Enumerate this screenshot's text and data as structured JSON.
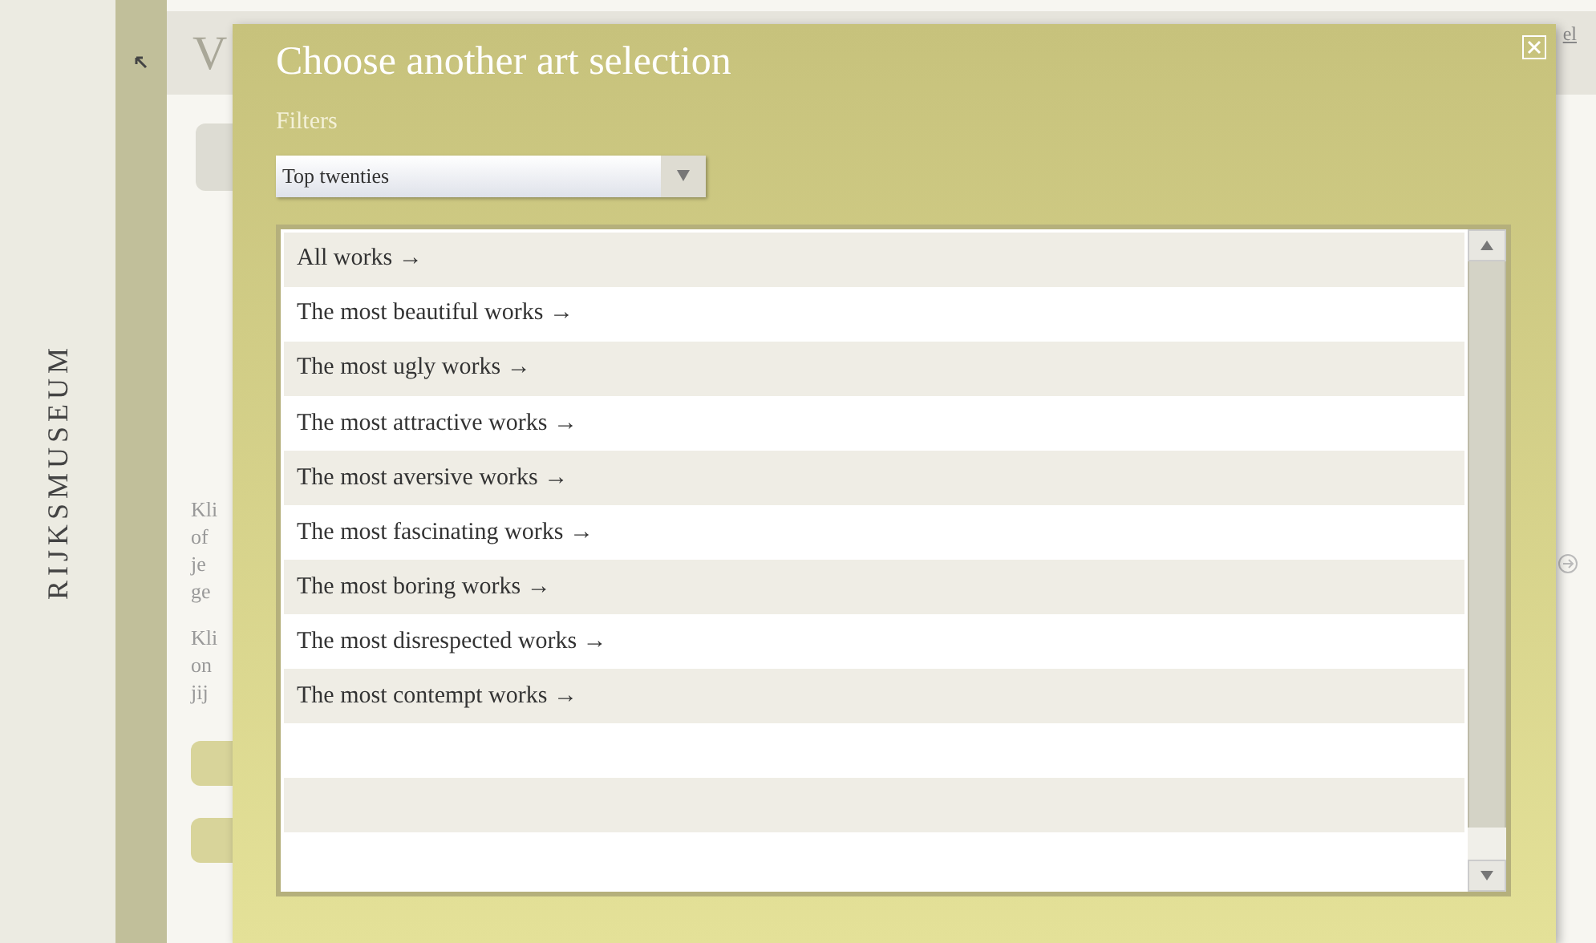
{
  "sidebar": {
    "logo": "RIJKSMUSEUM"
  },
  "page": {
    "title_fragment": "V",
    "link_fragment": "el",
    "paragraphs": [
      [
        "Kli",
        "of",
        "je",
        "ge"
      ],
      [
        "Kli",
        "on",
        "jij"
      ]
    ]
  },
  "dialog": {
    "title": "Choose another art selection",
    "filter_label": "Filters",
    "filter": {
      "value": "Top twenties"
    },
    "items": [
      {
        "label": "All works →"
      },
      {
        "label": "The most beautiful works →"
      },
      {
        "label": "The most ugly works →"
      },
      {
        "label": "The most attractive works →"
      },
      {
        "label": "The most aversive works →"
      },
      {
        "label": "The most fascinating works →"
      },
      {
        "label": "The most boring works →"
      },
      {
        "label": "The most disrespected works →"
      },
      {
        "label": "The most contempt works →"
      }
    ]
  }
}
